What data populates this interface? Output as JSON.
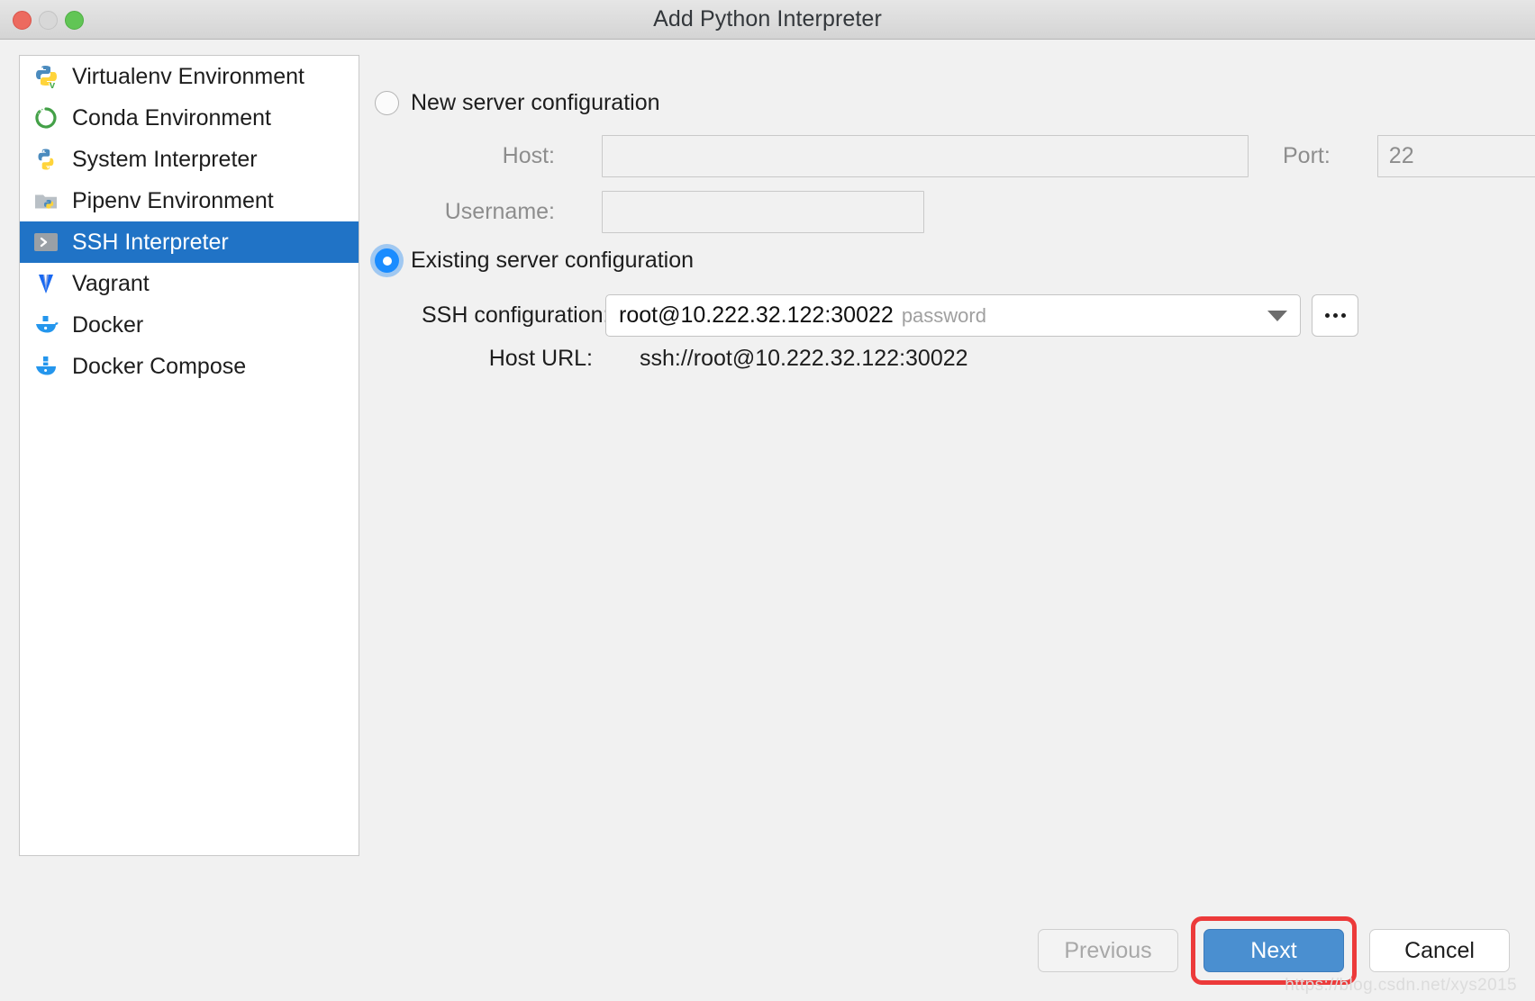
{
  "window": {
    "title": "Add Python Interpreter",
    "traffic_lights": [
      "close-button",
      "minimize-button",
      "maximize-button"
    ]
  },
  "sidebar": {
    "items": [
      {
        "label": "Virtualenv Environment",
        "icon": "python-venv-icon",
        "selected": false
      },
      {
        "label": "Conda Environment",
        "icon": "conda-icon",
        "selected": false
      },
      {
        "label": "System Interpreter",
        "icon": "python-icon",
        "selected": false
      },
      {
        "label": "Pipenv Environment",
        "icon": "pipenv-icon",
        "selected": false
      },
      {
        "label": "SSH Interpreter",
        "icon": "ssh-terminal-icon",
        "selected": true
      },
      {
        "label": "Vagrant",
        "icon": "vagrant-icon",
        "selected": false
      },
      {
        "label": "Docker",
        "icon": "docker-icon",
        "selected": false
      },
      {
        "label": "Docker Compose",
        "icon": "docker-compose-icon",
        "selected": false
      }
    ]
  },
  "main": {
    "new_server": {
      "radio_label": "New server configuration",
      "selected": false,
      "host_label": "Host:",
      "host_value": "",
      "host_placeholder": "",
      "port_label": "Port:",
      "port_value": "22",
      "username_label": "Username:",
      "username_value": "",
      "username_placeholder": ""
    },
    "existing_server": {
      "radio_label": "Existing server configuration",
      "selected": true,
      "ssh_config_label": "SSH configuration:",
      "ssh_config_value": "root@10.222.32.122:30022",
      "ssh_config_auth": "password",
      "browse_button_label": "...",
      "host_url_label": "Host URL:",
      "host_url_value": "ssh://root@10.222.32.122:30022"
    }
  },
  "footer": {
    "previous_label": "Previous",
    "next_label": "Next",
    "cancel_label": "Cancel"
  },
  "watermark": "https://blog.csdn.net/xys2015",
  "colors": {
    "selection_blue": "#2073c6",
    "primary_button": "#4a8fd0",
    "radio_accent": "#1a8cff",
    "annotation_red": "#ec3a3a"
  }
}
